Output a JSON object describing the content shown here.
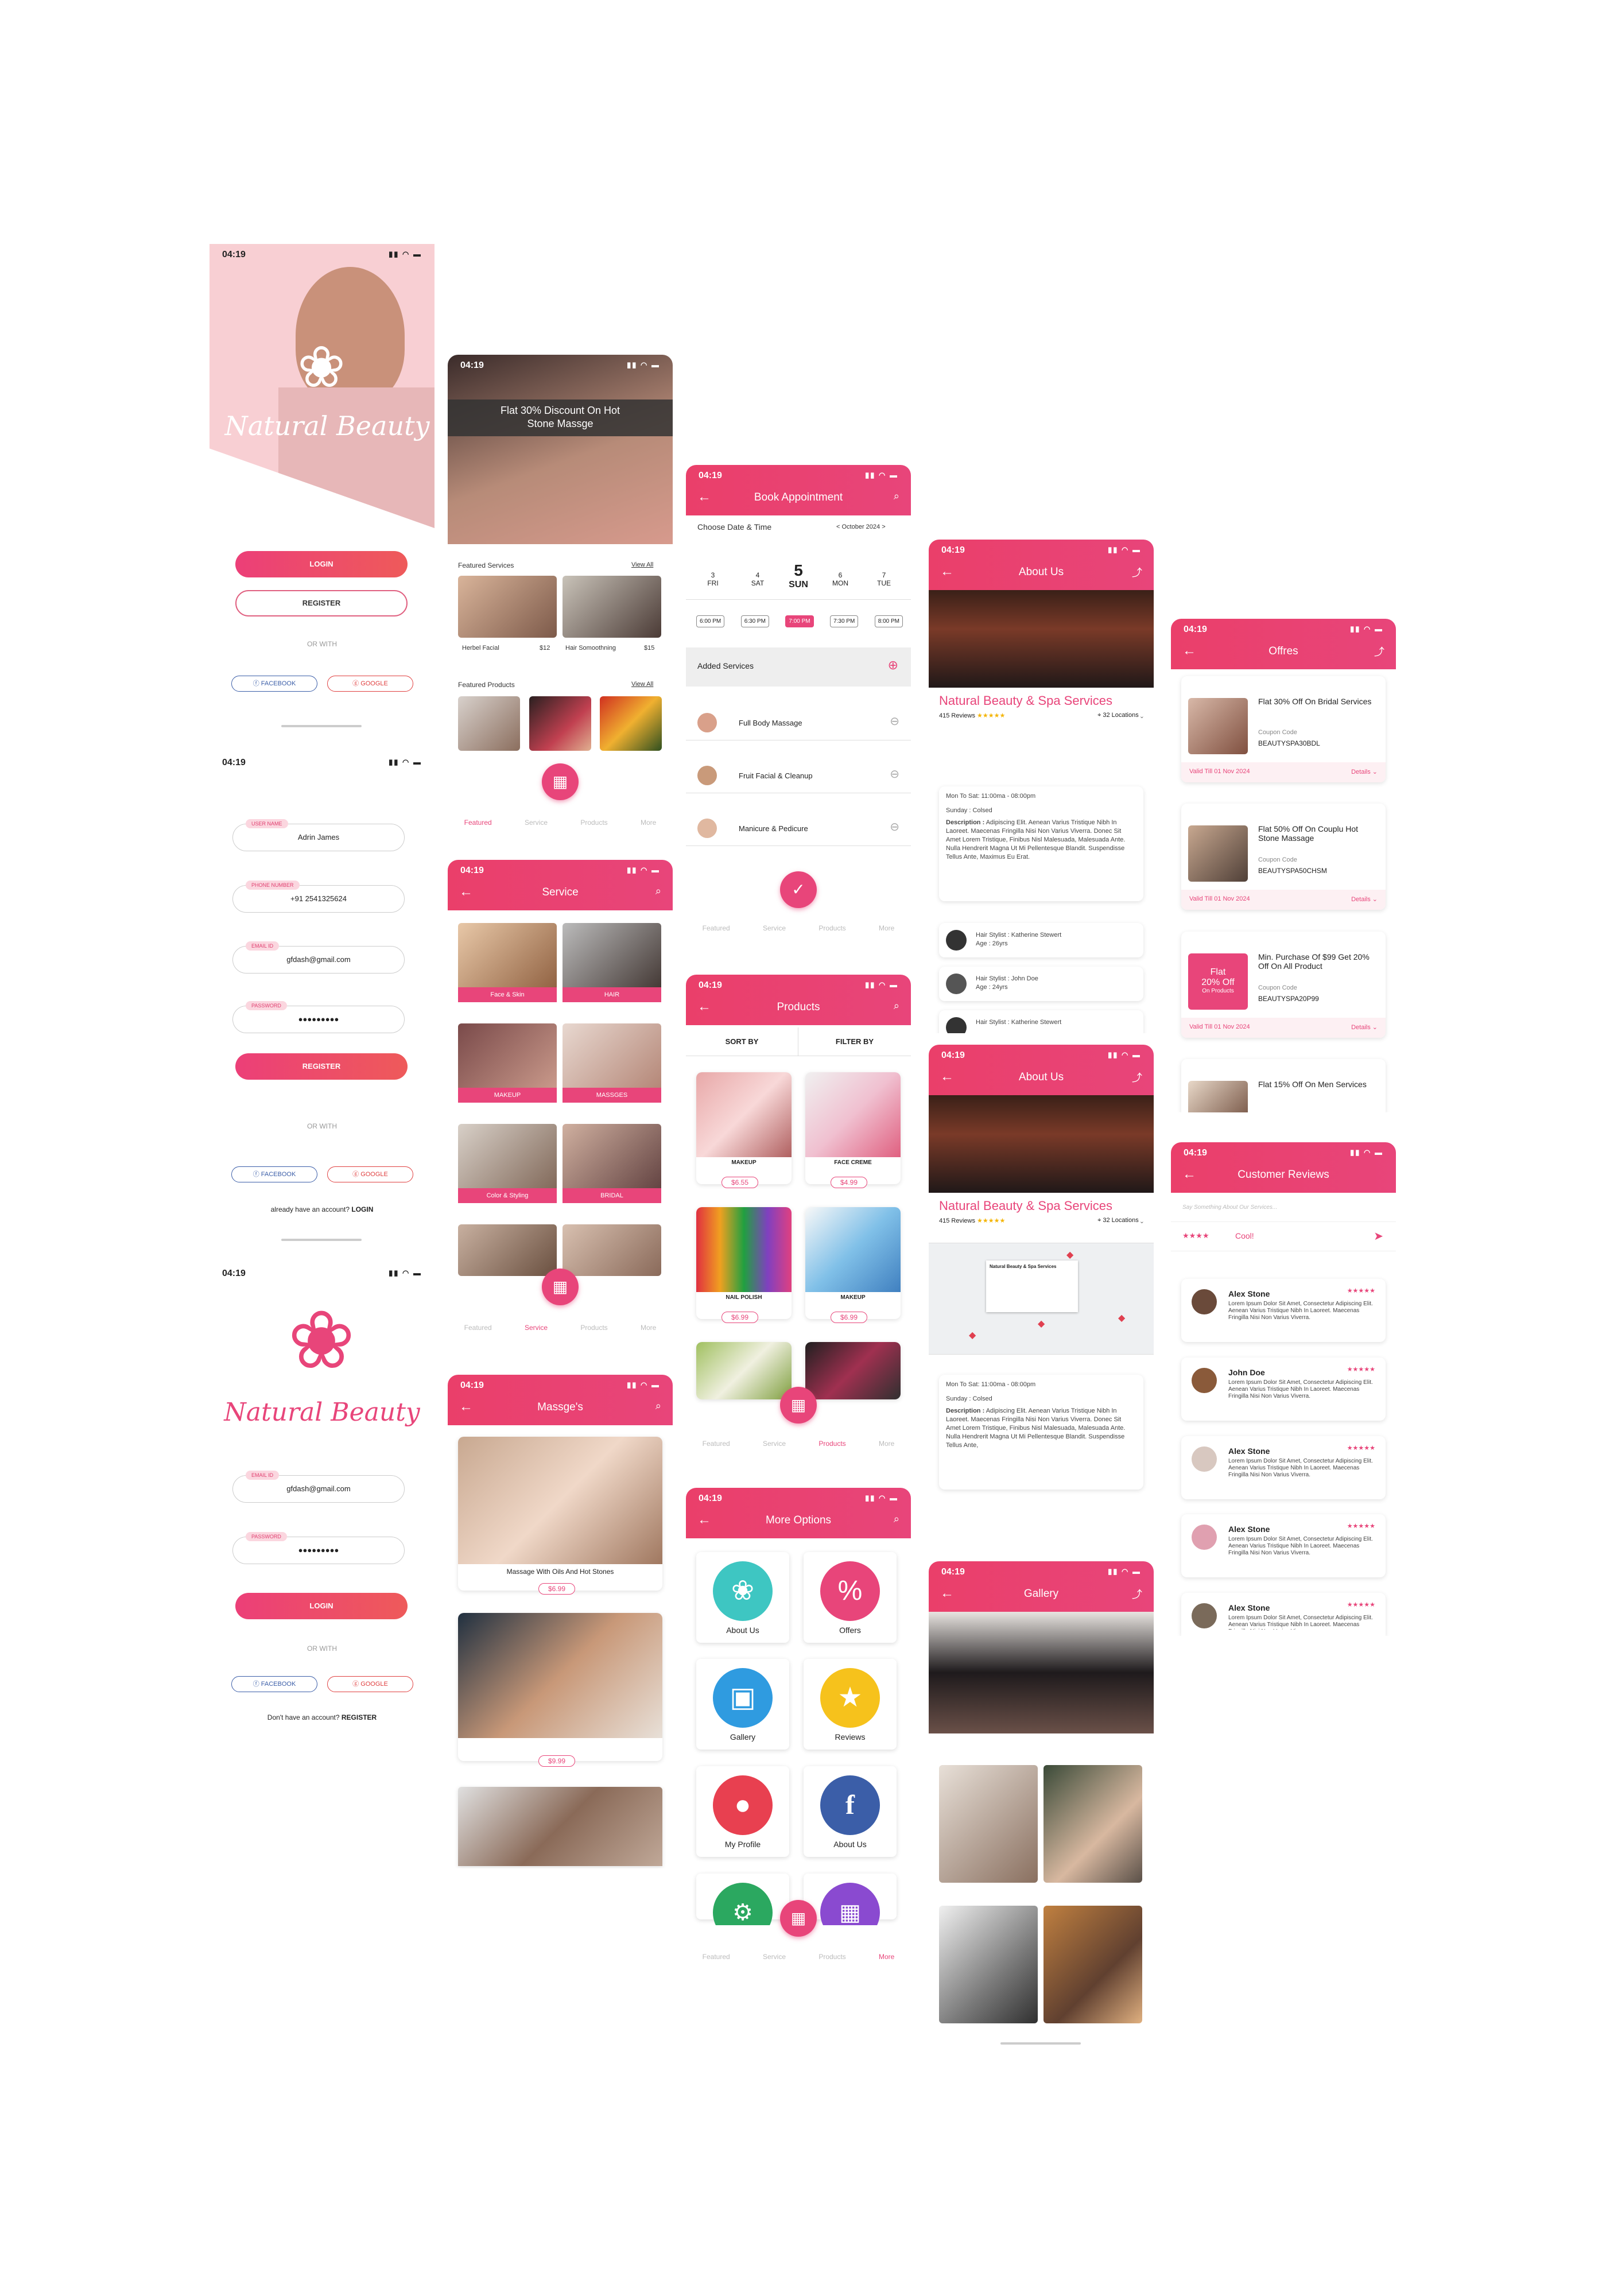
{
  "status_time": "04:19",
  "brand": "Natural Beauty",
  "login": {
    "login_btn": "LOGIN",
    "register_btn": "REGISTER",
    "or_with": "OR WITH",
    "facebook": "FACEBOOK",
    "google": "GOOGLE"
  },
  "register": {
    "user_name_label": "USER NAME",
    "user_name": "Adrin James",
    "phone_label": "PHONE NUMBER",
    "phone": "+91 2541325624",
    "email_label": "EMAIL ID",
    "email": "gfdash@gmail.com",
    "password_label": "PASSWORD",
    "password": "●●●●●●●●●",
    "register_btn": "REGISTER",
    "or_with": "OR WITH",
    "facebook": "FACEBOOK",
    "google": "GOOGLE",
    "have_account": "already have an account?",
    "login_link": "LOGIN"
  },
  "signin": {
    "email_label": "EMAIL ID",
    "email": "gfdash@gmail.com",
    "password_label": "PASSWORD",
    "password": "●●●●●●●●●",
    "login_btn": "LOGIN",
    "or_with": "OR WITH",
    "facebook": "FACEBOOK",
    "google": "GOOGLE",
    "no_account": "Don't have an account?",
    "register_link": "REGISTER"
  },
  "home": {
    "banner": "Flat 30% Discount On Hot Stone Massge",
    "featured_services": "Featured Services",
    "view_all": "View All",
    "services": [
      {
        "name": "Herbel Facial",
        "price": "$12"
      },
      {
        "name": "Hair Somoothning",
        "price": "$15"
      }
    ],
    "featured_products": "Featured Products"
  },
  "nav": {
    "featured": "Featured",
    "service": "Service",
    "products": "Products",
    "more": "More"
  },
  "service": {
    "title": "Service",
    "items": [
      "Face & Skin",
      "HAIR",
      "MAKEUP",
      "MASSGES",
      "Color & Styling",
      "BRIDAL"
    ]
  },
  "massages": {
    "title": "Massge's",
    "items": [
      {
        "name": "Massage With Oils And Hot Stones",
        "price": "$6.99"
      },
      {
        "name": "",
        "price": "$9.99"
      }
    ]
  },
  "booking": {
    "title": "Book Appointment",
    "choose": "Choose Date & Time",
    "month": "< October 2024 >",
    "days": [
      {
        "n": "3",
        "d": "FRI"
      },
      {
        "n": "4",
        "d": "SAT"
      },
      {
        "n": "5",
        "d": "SUN"
      },
      {
        "n": "6",
        "d": "MON"
      },
      {
        "n": "7",
        "d": "TUE"
      }
    ],
    "times": [
      "6:00 PM",
      "6:30 PM",
      "7:00 PM",
      "7:30 PM",
      "8:00 PM"
    ],
    "added": "Added Services",
    "services": [
      "Full Body Massage",
      "Fruit Facial & Cleanup",
      "Manicure & Pedicure"
    ]
  },
  "products": {
    "title": "Products",
    "sort": "SORT BY",
    "filter": "FILTER BY",
    "items": [
      {
        "name": "MAKEUP",
        "price": "$6.55"
      },
      {
        "name": "FACE CREME",
        "price": "$4.99"
      },
      {
        "name": "NAIL POLISH",
        "price": "$6.99"
      },
      {
        "name": "MAKEUP",
        "price": "$6.99"
      }
    ]
  },
  "more": {
    "title": "More Options",
    "items": [
      "About Us",
      "Offers",
      "Gallery",
      "Reviews",
      "My Profile",
      "About Us"
    ]
  },
  "about": {
    "title": "About Us",
    "name": "Natural Beauty & Spa Services",
    "reviews": "415 Reviews",
    "stars": "★★★★★",
    "locations": "32 Locations",
    "hours": "Mon To Sat: 11:00ma - 08:00pm",
    "sunday": "Sunday : Colsed",
    "desc_label": "Description :",
    "desc": "Adipiscing Elit. Aenean Varius Tristique Nibh In Laoreet. Maecenas Fringilla Nisi Non Varius Viverra. Donec Sit Amet Lorem Tristique, Finibus Nisl Malesuada, Malesuada Ante. Nulla Hendrerit Magna Ut Mi Pellentesque Blandit. Suspendisse Tellus Ante, Maximus Eu Erat.",
    "desc_short": "Adipiscing Elit. Aenean Varius Tristique Nibh In Laoreet. Maecenas Fringilla Nisi Non Varius Viverra. Donec Sit Amet Lorem Tristique, Finibus Nisl Malesuada, Malesuada Ante. Nulla Hendrerit Magna Ut Mi Pellentesque Blandit. Suspendisse Tellus Ante,",
    "stylists": [
      {
        "name": "Hair Stylist : Katherine Stewert",
        "age": "Age : 26yrs"
      },
      {
        "name": "Hair Stylist : John Doe",
        "age": "Age : 24yrs"
      }
    ],
    "map_label": "Natural Beauty & Spa Services"
  },
  "gallery": {
    "title": "Gallery"
  },
  "offers": {
    "title": "Offres",
    "coupon_label": "Coupon Code",
    "details": "Details",
    "items": [
      {
        "title": "Flat 30% Off On Bridal Services",
        "code": "BEAUTYSPA30BDL",
        "valid": "Valid Till 01 Nov 2024"
      },
      {
        "title": "Flat 50% Off On Couplu Hot Stone Massage",
        "code": "BEAUTYSPA50CHSM",
        "valid": "Valid Till 01 Nov 2024"
      },
      {
        "title": "Min. Purchase Of $99 Get 20% Off On All Product",
        "code": "BEAUTYSPA20P99",
        "valid": "Valid Till 01 Nov 2024",
        "badge1": "Flat",
        "badge2": "20% Off",
        "badge3": "On Products"
      },
      {
        "title": "Flat 15% Off On Men Services"
      }
    ]
  },
  "reviews": {
    "title": "Customer Reviews",
    "placeholder": "Say Something About Our Services...",
    "my_stars": "★★★★",
    "my_text": "Cool!",
    "text": "Lorem Ipsum Dolor Sit Amet, Consectetur Adipiscing Elit. Aenean Varius Tristique Nibh In Laoreet. Maecenas Fringilla Nisi Non Varius Viverra.",
    "items": [
      {
        "name": "Alex Stone",
        "stars": "★★★★★"
      },
      {
        "name": "John Doe",
        "stars": "★★★★★"
      },
      {
        "name": "Alex Stone",
        "stars": "★★★★★"
      },
      {
        "name": "Alex Stone",
        "stars": "★★★★★"
      },
      {
        "name": "Alex Stone",
        "stars": "★★★★★"
      }
    ]
  }
}
